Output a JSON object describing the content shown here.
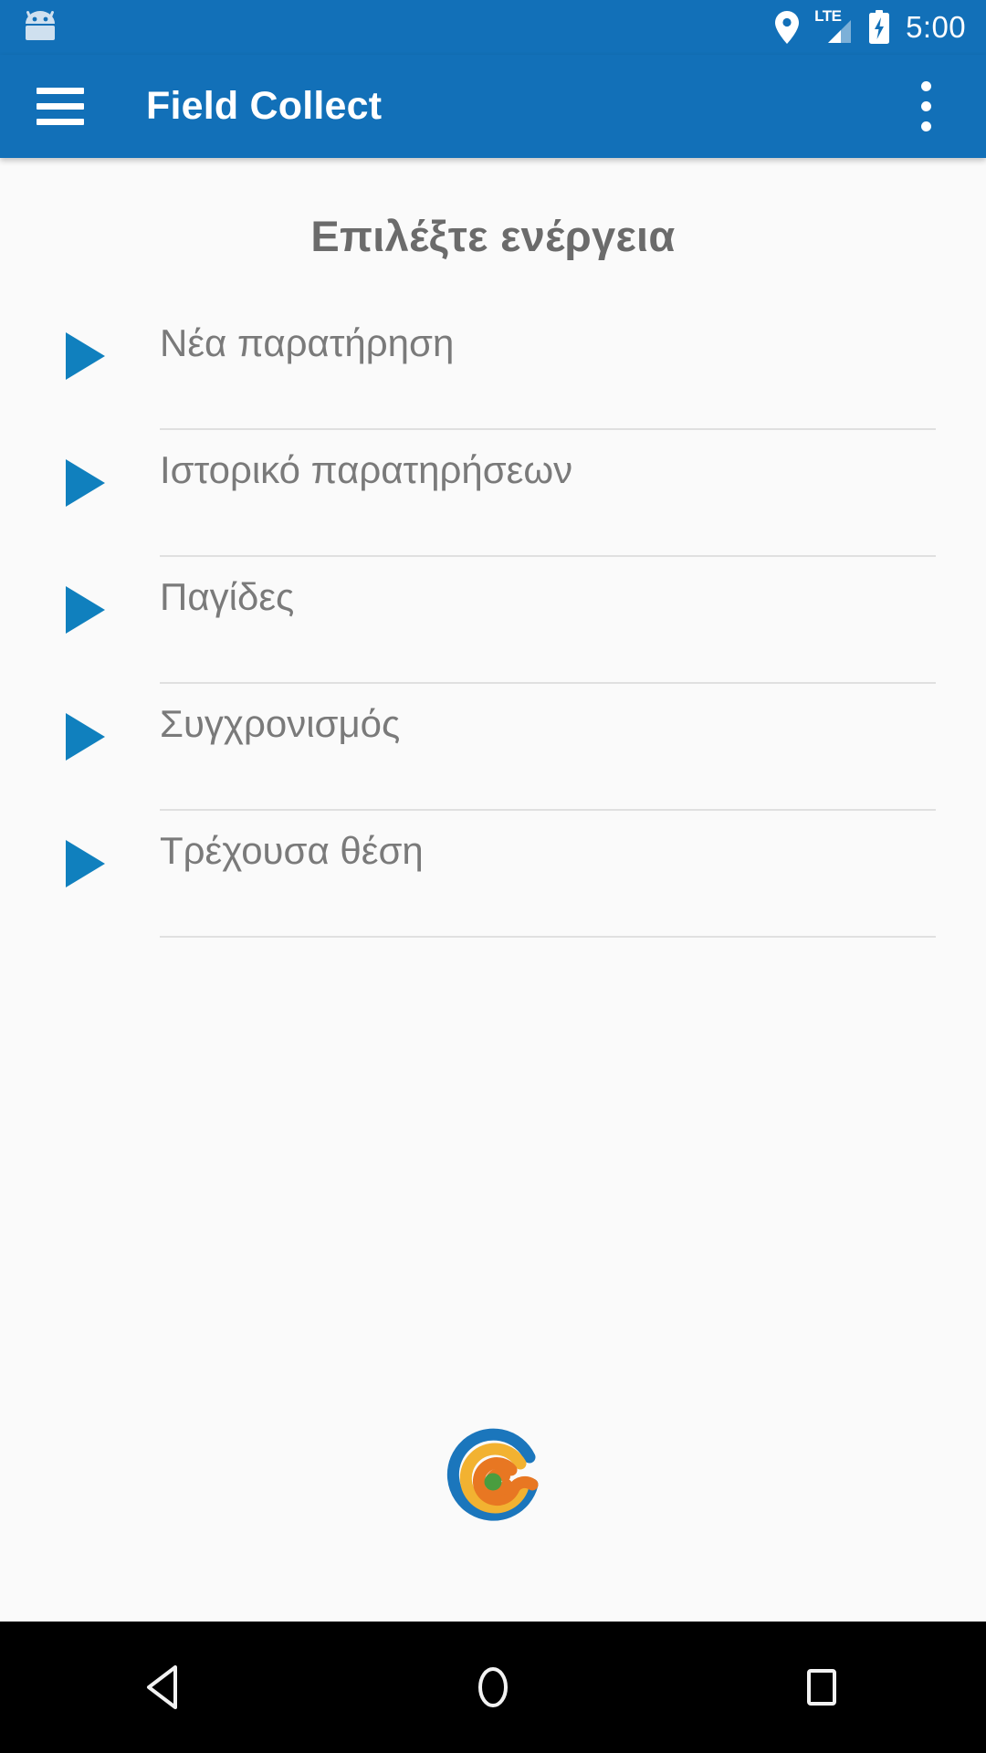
{
  "theme": {
    "primary": "#1270b8",
    "accent_triangle": "#1080be",
    "background": "#fafafa",
    "text_muted": "#7a7a7a",
    "title_color": "#6b6b6b",
    "divider": "#e0e0e0",
    "navbar_background": "#000000"
  },
  "status_bar": {
    "robot_icon": "android-robot-icon",
    "location_icon": "location-pin-icon",
    "network_label": "LTE",
    "signal_icon": "signal-bars-icon",
    "battery_icon": "battery-charging-icon",
    "time": "5:00"
  },
  "app_bar": {
    "menu_icon": "hamburger-menu-icon",
    "title": "Field Collect",
    "overflow_icon": "more-vert-icon"
  },
  "main": {
    "section_title": "Επιλέξτε ενέργεια",
    "actions": [
      {
        "label": "Νέα παρατήρηση",
        "bullet_icon": "play-triangle-icon"
      },
      {
        "label": "Ιστορικό παρατηρήσεων",
        "bullet_icon": "play-triangle-icon"
      },
      {
        "label": "Παγίδες",
        "bullet_icon": "play-triangle-icon"
      },
      {
        "label": "Συγχρονισμός",
        "bullet_icon": "play-triangle-icon"
      },
      {
        "label": "Τρέχουσα θέση",
        "bullet_icon": "play-triangle-icon"
      }
    ],
    "logo": {
      "name": "spiral-logo",
      "colors": [
        "#1b76bc",
        "#f2b231",
        "#e87722",
        "#4a9d3f"
      ]
    }
  },
  "nav_bar": {
    "back": "back-triangle-icon",
    "home": "home-circle-icon",
    "recents": "recents-square-icon"
  }
}
